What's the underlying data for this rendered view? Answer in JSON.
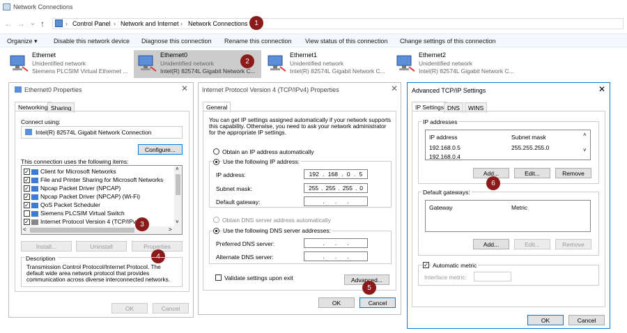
{
  "window": {
    "title": "Network Connections"
  },
  "address": {
    "crumbs": [
      "Control Panel",
      "Network and Internet",
      "Network Connections"
    ],
    "sep": "›"
  },
  "nav": {
    "back": "←",
    "forward": "→",
    "down": "⌄",
    "up": "↑"
  },
  "cmdbar": {
    "organize": "Organize ▾",
    "disable": "Disable this network device",
    "diagnose": "Diagnose this connection",
    "rename": "Rename this connection",
    "view_status": "View status of this connection",
    "change_settings": "Change settings of this connection"
  },
  "adapters": [
    {
      "name": "Ethernet",
      "status": "Unidentified network",
      "device": "Siemens PLCSIM Virtual Ethernet ..."
    },
    {
      "name": "Ethernet0",
      "status": "Unidentified network",
      "device": "Intel(R) 82574L Gigabit Network C..."
    },
    {
      "name": "Ethernet1",
      "status": "Unidentified network",
      "device": "Intel(R) 82574L Gigabit Network C..."
    },
    {
      "name": "Ethernet2",
      "status": "Unidentified network",
      "device": "Intel(R) 82574L Gigabit Network C..."
    }
  ],
  "badges": [
    "1",
    "2",
    "3",
    "4",
    "5",
    "6"
  ],
  "props": {
    "title": "Ethernet0 Properties",
    "tabs": [
      "Networking",
      "Sharing"
    ],
    "connect_using_label": "Connect using:",
    "adapter": "Intel(R) 82574L Gigabit Network Connection",
    "configure": "Configure...",
    "items_label": "This connection uses the following items:",
    "items": [
      "Client for Microsoft Networks",
      "File and Printer Sharing for Microsoft Networks",
      "Npcap Packet Driver (NPCAP)",
      "Npcap Packet Driver (NPCAP) (Wi-Fi)",
      "QoS Packet Scheduler",
      "Siemens PLCSIM Virtual Switch",
      "Internet Protocol Version 4 (TCP/IPv4)"
    ],
    "install": "Install...",
    "uninstall": "Uninstall",
    "properties": "Properties",
    "description_label": "Description",
    "description": "Transmission Control Protocol/Internet Protocol. The default wide area network protocol that provides communication across diverse interconnected networks.",
    "ok": "OK",
    "cancel": "Cancel"
  },
  "ipv4": {
    "title": "Internet Protocol Version 4 (TCP/IPv4) Properties",
    "tab": "General",
    "intro": "You can get IP settings assigned automatically if your network supports this capability. Otherwise, you need to ask your network administrator for the appropriate IP settings.",
    "obtain_auto": "Obtain an IP address automatically",
    "use_following": "Use the following IP address:",
    "ip_label": "IP address:",
    "ip": [
      "192",
      "168",
      "0",
      "5"
    ],
    "mask_label": "Subnet mask:",
    "mask": [
      "255",
      "255",
      "255",
      "0"
    ],
    "gw_label": "Default gateway:",
    "dns_auto": "Obtain DNS server address automatically",
    "dns_use": "Use the following DNS server addresses:",
    "pref_dns": "Preferred DNS server:",
    "alt_dns": "Alternate DNS server:",
    "validate": "Validate settings upon exit",
    "advanced": "Advanced...",
    "ok": "OK",
    "cancel": "Cancel",
    "dot": "."
  },
  "advanced": {
    "title": "Advanced TCP/IP Settings",
    "tabs": [
      "IP Settings",
      "DNS",
      "WINS"
    ],
    "ip_group": "IP addresses",
    "col_ip": "IP address",
    "col_mask": "Subnet mask",
    "rows": [
      {
        "ip": "192.168.0.5",
        "mask": "255.255.255.0"
      },
      {
        "ip": "192.168.0.4",
        "mask": ""
      }
    ],
    "add": "Add...",
    "edit": "Edit...",
    "remove": "Remove",
    "gw_group": "Default gateways:",
    "col_gw": "Gateway",
    "col_metric": "Metric",
    "auto_metric": "Automatic metric",
    "iface_metric": "Interface metric:",
    "ok": "OK",
    "cancel": "Cancel"
  },
  "icons": {
    "close": "✕",
    "check": "✓",
    "scroll_up": "˄",
    "scroll_down": "˅",
    "scroll_left": "<",
    "scroll_right": ">"
  }
}
